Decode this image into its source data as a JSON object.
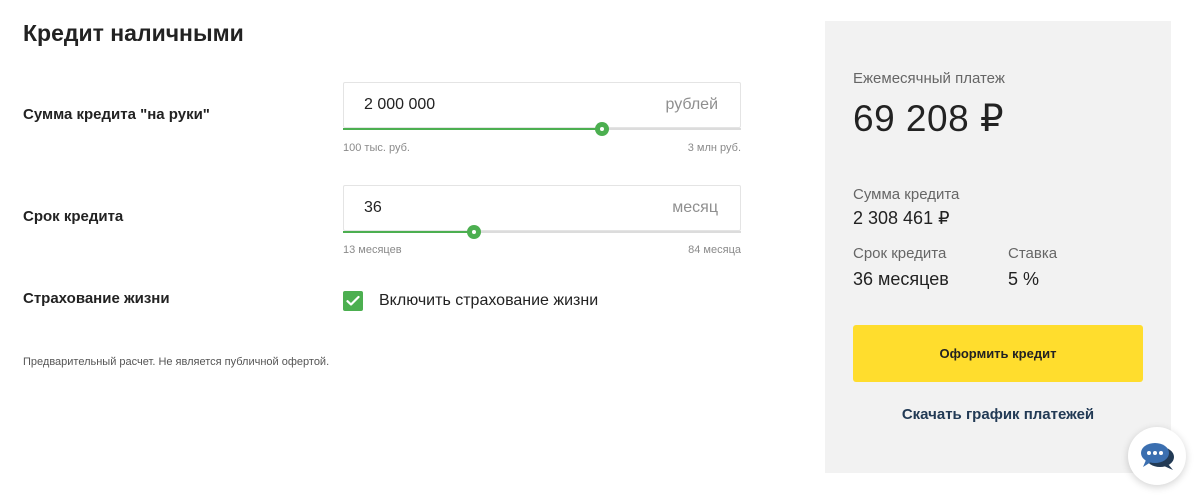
{
  "title": "Кредит наличными",
  "amount": {
    "label": "Сумма кредита \"на руки\"",
    "value": "2 000 000",
    "unit": "рублей",
    "min_label": "100 тыс. руб.",
    "max_label": "3 млн руб.",
    "slider_fraction": 0.65
  },
  "term": {
    "label": "Срок кредита",
    "value": "36",
    "unit": "месяц",
    "min_label": "13 месяцев",
    "max_label": "84 месяца",
    "slider_fraction": 0.33
  },
  "insurance": {
    "label": "Страхование жизни",
    "checkbox_label": "Включить страхование жизни",
    "checked": true
  },
  "disclaimer": "Предварительный расчет. Не является публичной офертой.",
  "summary": {
    "monthly_label": "Ежемесячный платеж",
    "monthly_value": "69 208 ₽",
    "credit_sum_label": "Сумма кредита",
    "credit_sum_value": "2 308 461 ₽",
    "term_label": "Срок кредита",
    "term_value": "36 месяцев",
    "rate_label": "Ставка",
    "rate_value": "5 %"
  },
  "apply_button": "Оформить кредит",
  "schedule_link": "Скачать график платежей",
  "colors": {
    "accent_green": "#4caf50",
    "button_yellow": "#ffdd2d",
    "panel_bg": "#f2f2f2"
  },
  "icons": {
    "checkbox": "check-icon",
    "chat": "chat-bubble-icon"
  }
}
